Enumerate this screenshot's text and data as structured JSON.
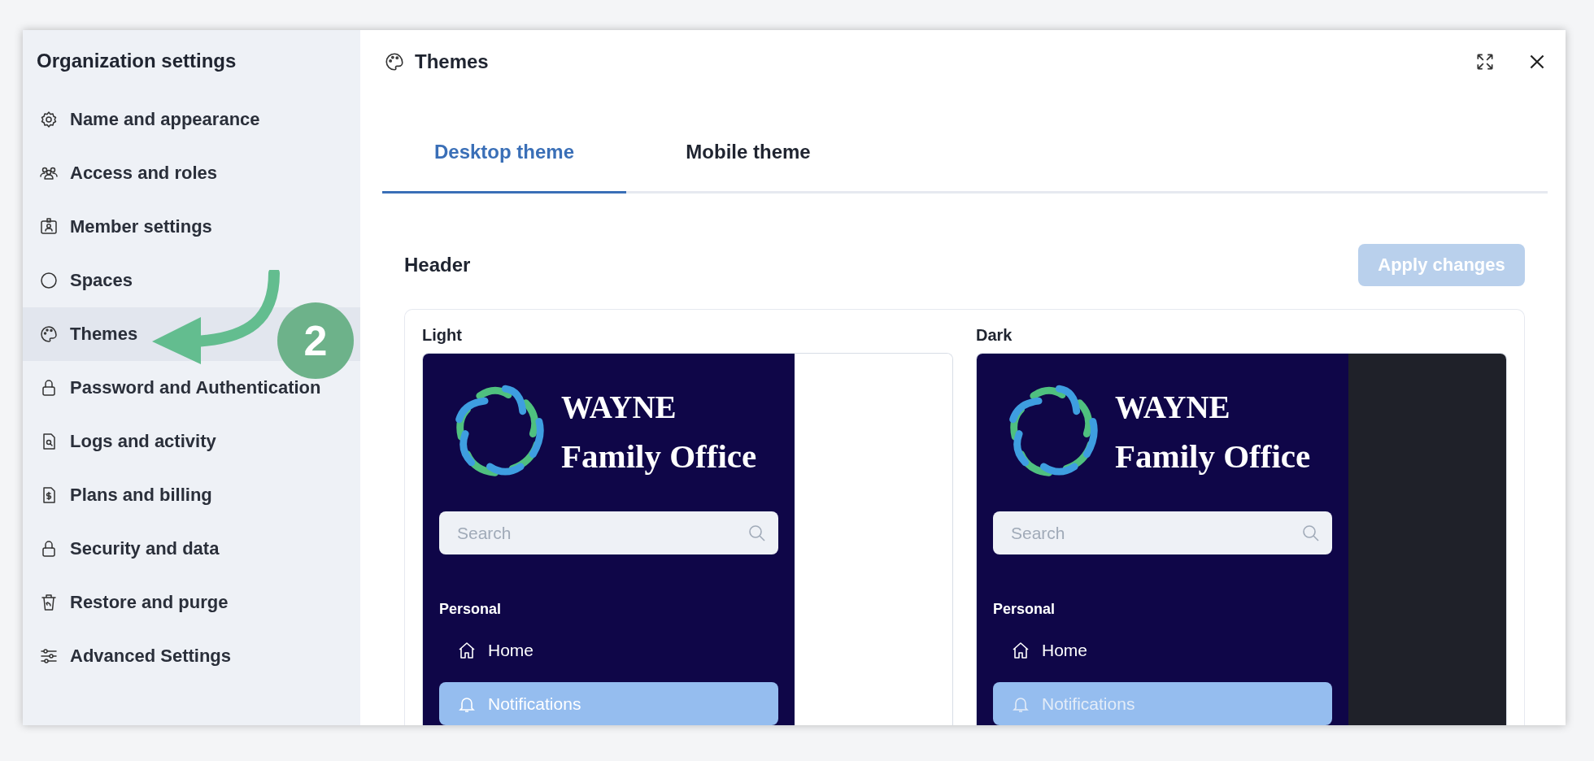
{
  "sidebar": {
    "title": "Organization settings",
    "items": [
      {
        "label": "Name and appearance",
        "selected": false
      },
      {
        "label": "Access and roles",
        "selected": false
      },
      {
        "label": "Member settings",
        "selected": false
      },
      {
        "label": "Spaces",
        "selected": false
      },
      {
        "label": "Themes",
        "selected": true
      },
      {
        "label": "Password and Authentication",
        "selected": false
      },
      {
        "label": "Logs and activity",
        "selected": false
      },
      {
        "label": "Plans and billing",
        "selected": false
      },
      {
        "label": "Security and data",
        "selected": false
      },
      {
        "label": "Restore and purge",
        "selected": false
      },
      {
        "label": "Advanced Settings",
        "selected": false
      }
    ]
  },
  "annotation": {
    "step": "2"
  },
  "panel": {
    "title": "Themes",
    "tabs": [
      {
        "label": "Desktop theme",
        "selected": true
      },
      {
        "label": "Mobile theme",
        "selected": false
      }
    ],
    "section": "Header",
    "apply_button": {
      "label": "Apply changes",
      "disabled": true
    },
    "previews": [
      {
        "label": "Light",
        "kind": "light",
        "brand": [
          "WAYNE",
          "Family Office"
        ],
        "search_placeholder": "Search",
        "group": "Personal",
        "nav": [
          {
            "label": "Home",
            "selected": false
          },
          {
            "label": "Notifications",
            "selected": true
          }
        ]
      },
      {
        "label": "Dark",
        "kind": "dark",
        "brand": [
          "WAYNE",
          "Family Office"
        ],
        "search_placeholder": "Search",
        "group": "Personal",
        "nav": [
          {
            "label": "Home",
            "selected": false
          },
          {
            "label": "Notifications",
            "selected": true
          }
        ]
      }
    ]
  }
}
